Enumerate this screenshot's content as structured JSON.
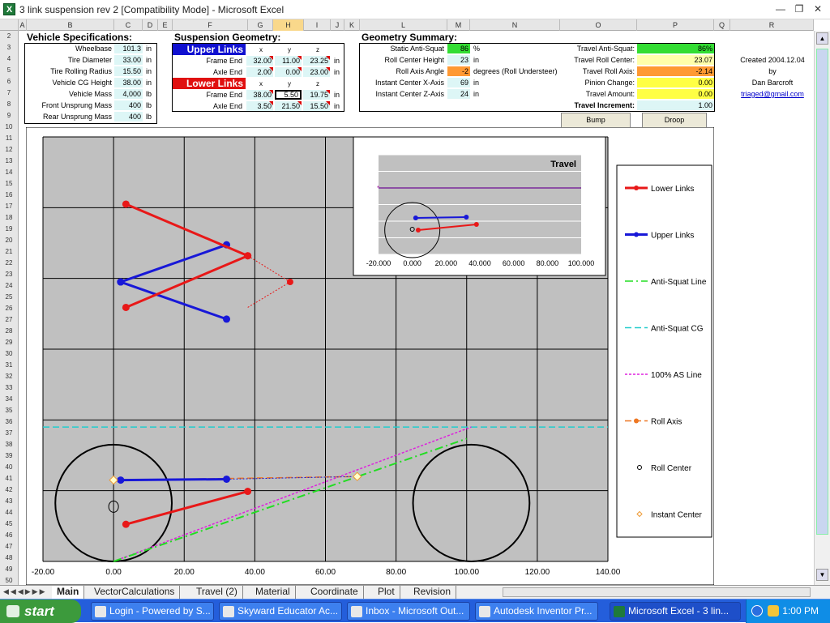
{
  "window": {
    "title": "3 link suspension rev 2  [Compatibility Mode] - Microsoft Excel",
    "app_icon": "X"
  },
  "columns": [
    "A",
    "B",
    "C",
    "D",
    "E",
    "F",
    "G",
    "H",
    "I",
    "J",
    "K",
    "L",
    "M",
    "N",
    "O",
    "P",
    "Q",
    "R"
  ],
  "rows": [
    "2",
    "3",
    "4",
    "5",
    "6",
    "7",
    "8",
    "9",
    "10",
    "11",
    "12",
    "13",
    "14",
    "15",
    "16",
    "17",
    "18",
    "19",
    "20",
    "21",
    "22",
    "23",
    "24",
    "25",
    "26",
    "27",
    "28",
    "29",
    "30",
    "31",
    "32",
    "33",
    "34",
    "35",
    "36",
    "37",
    "38",
    "39",
    "40",
    "41",
    "42",
    "43",
    "44",
    "45",
    "46",
    "47",
    "48",
    "49",
    "50"
  ],
  "vehicle": {
    "title": "Vehicle Specifications:",
    "items": [
      {
        "label": "Wheelbase",
        "value": "101.3",
        "unit": "in"
      },
      {
        "label": "Tire Diameter",
        "value": "33.00",
        "unit": "in"
      },
      {
        "label": "Tire Rolling Radius",
        "value": "15.50",
        "unit": "in"
      },
      {
        "label": "Vehicle CG Height",
        "value": "38.00",
        "unit": "in"
      },
      {
        "label": "Vehicle Mass",
        "value": "4,000",
        "unit": "lb"
      },
      {
        "label": "Front Unsprung Mass",
        "value": "400",
        "unit": "lb"
      },
      {
        "label": "Rear Unsprung Mass",
        "value": "400",
        "unit": "lb"
      }
    ]
  },
  "geometry": {
    "title": "Suspension Geometry:",
    "upper": {
      "header": "Upper Links",
      "cols": [
        "x",
        "y",
        "z"
      ],
      "rows": [
        {
          "label": "Frame End",
          "values": [
            "32.00",
            "11.00",
            "23.25"
          ],
          "unit": "in"
        },
        {
          "label": "Axle End",
          "values": [
            "2.00",
            "0.00",
            "23.00"
          ],
          "unit": "in"
        }
      ]
    },
    "lower": {
      "header": "Lower Links",
      "cols": [
        "x",
        "y",
        "z"
      ],
      "rows": [
        {
          "label": "Frame End",
          "values": [
            "38.00",
            "5.50",
            "19.75"
          ],
          "unit": "in"
        },
        {
          "label": "Axle End",
          "values": [
            "3.50",
            "21.50",
            "15.50"
          ],
          "unit": "in"
        }
      ]
    }
  },
  "summary": {
    "title": "Geometry Summary:",
    "left": [
      {
        "label": "Static Anti-Squat",
        "value": "86",
        "unit": "%",
        "color": "#33dd33"
      },
      {
        "label": "Roll Center Height",
        "value": "23",
        "unit": "in",
        "color": "#ddf6f6"
      },
      {
        "label": "Roll Axis Angle",
        "value": "-2",
        "unit": "degrees (Roll Understeer)",
        "color": "#ff9933"
      },
      {
        "label": "Instant Center X-Axis",
        "value": "69",
        "unit": "in",
        "color": "#ddf6f6"
      },
      {
        "label": "Instant Center Z-Axis",
        "value": "24",
        "unit": "in",
        "color": "#ddf6f6"
      }
    ],
    "right": [
      {
        "label": "Travel Anti-Squat:",
        "value": "86%",
        "color": "#33dd33"
      },
      {
        "label": "Travel Roll Center:",
        "value": "23.07",
        "color": "#ffffaa"
      },
      {
        "label": "Travel Roll Axis:",
        "value": "-2.14",
        "color": "#ff9933"
      },
      {
        "label": "Pinion Change:",
        "value": "0.00",
        "color": "#ffff44"
      },
      {
        "label": "Travel Amount:",
        "value": "0.00",
        "color": "#ffff44"
      },
      {
        "label": "Travel Increment:",
        "value": "1.00",
        "color": "#ddf6f6"
      }
    ],
    "bump": "Bump",
    "droop": "Droop"
  },
  "credits": {
    "created": "Created 2004.12.04",
    "by": "by",
    "author": "Dan Barcroft",
    "email": "triaged@gmail.com"
  },
  "chart_data": [
    {
      "type": "scatter",
      "title": "",
      "xlim": [
        -20,
        140
      ],
      "ylim": [
        0,
        120
      ],
      "grid": true,
      "xticks": [
        "-20.00",
        "0.00",
        "20.00",
        "40.00",
        "60.00",
        "80.00",
        "100.00",
        "120.00",
        "140.00"
      ],
      "series": [
        {
          "name": "Lower Links",
          "color": "#e81818",
          "segments": [
            [
              [
                3.5,
                101
              ],
              [
                38,
                86.4
              ]
            ],
            [
              [
                38,
                86.4
              ],
              [
                3.5,
                71.8
              ]
            ],
            [
              [
                3.5,
                10.5
              ],
              [
                38,
                19.8
              ]
            ]
          ]
        },
        {
          "name": "Upper Links",
          "color": "#1818d8",
          "segments": [
            [
              [
                32,
                89.5
              ],
              [
                2,
                79
              ]
            ],
            [
              [
                2,
                79
              ],
              [
                32,
                68.5
              ]
            ],
            [
              [
                2,
                23
              ],
              [
                32,
                23.25
              ]
            ]
          ]
        },
        {
          "name": "Anti-Squat Line",
          "color": "#22dd22",
          "points": [
            [
              0,
              0
            ],
            [
              100,
              34.7
            ]
          ]
        },
        {
          "name": "Anti-Squat CG",
          "color": "#22cccc",
          "points": [
            [
              -20,
              38
            ],
            [
              140,
              38
            ]
          ]
        },
        {
          "name": "100% AS Line",
          "color": "#dd22dd",
          "points": [
            [
              0,
              0
            ],
            [
              101.3,
              38
            ]
          ]
        },
        {
          "name": "Roll Axis",
          "color": "#ee7722",
          "points": [
            [
              2,
              23
            ],
            [
              69,
              24
            ]
          ]
        },
        {
          "name": "Roll Center",
          "color": "#000000",
          "points": [
            [
              0,
              15.5
            ]
          ]
        },
        {
          "name": "Instant Center",
          "color": "#ee9933",
          "points": [
            [
              0,
              23
            ],
            [
              69,
              24
            ]
          ]
        }
      ],
      "wheels": [
        {
          "x": 0,
          "z": 16.5,
          "r": 16.5
        },
        {
          "x": 101.3,
          "z": 16.5,
          "r": 16.5
        }
      ]
    },
    {
      "type": "line",
      "title": "Travel",
      "xlim": [
        -20,
        100
      ],
      "xticks": [
        "-20.000",
        "0.000",
        "20.000",
        "40.000",
        "60.000",
        "80.000",
        "100.000"
      ]
    }
  ],
  "legend": [
    "Lower Links",
    "Upper Links",
    "Anti-Squat Line",
    "Anti-Squat CG",
    "100% AS Line",
    "Roll Axis",
    "Roll Center",
    "Instant Center"
  ],
  "tabs": [
    "Main",
    "VectorCalculations",
    "Travel (2)",
    "Material",
    "Coordinate",
    "Plot",
    "Revision"
  ],
  "taskbar": {
    "start": "start",
    "items": [
      "Login - Powered by S...",
      "Skyward Educator Ac...",
      "Inbox - Microsoft Out...",
      "Autodesk Inventor Pr...",
      "Microsoft Excel - 3 lin..."
    ],
    "time": "1:00 PM"
  }
}
